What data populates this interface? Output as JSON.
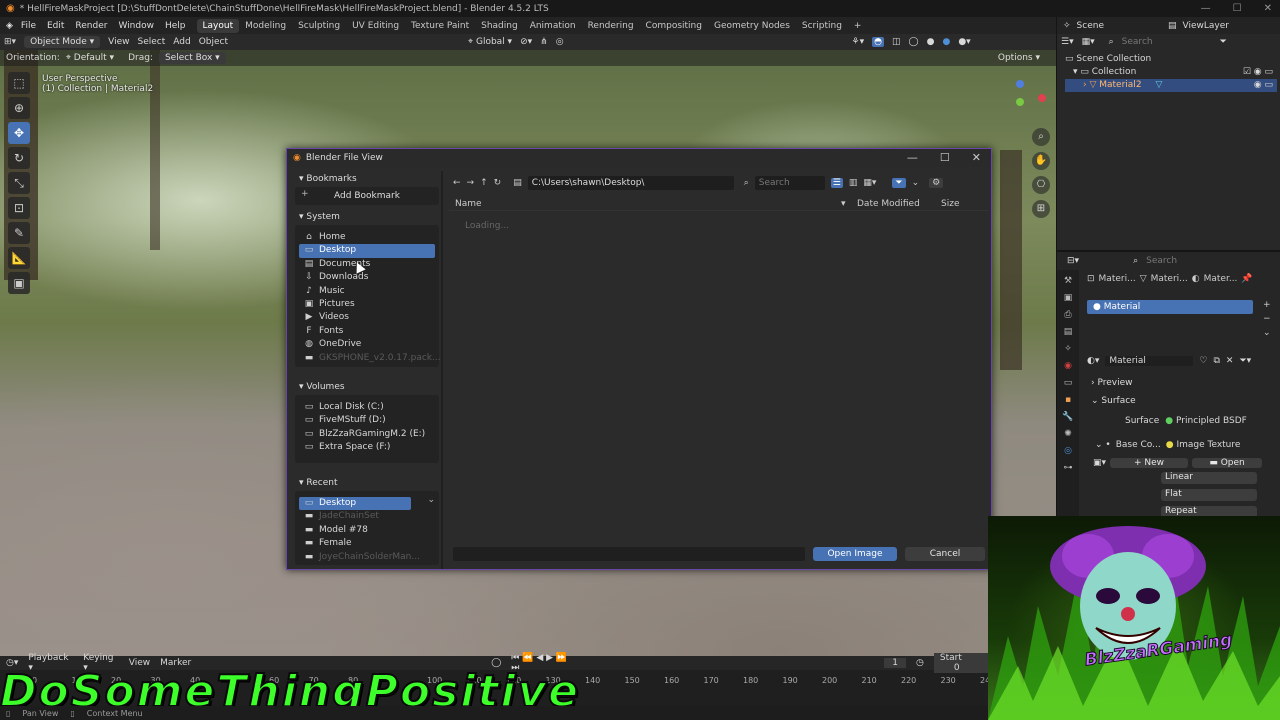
{
  "window": {
    "title": "* HellFireMaskProject [D:\\StuffDontDelete\\ChainStuffDone\\HellFireMask\\HellFireMaskProject.blend] - Blender 4.5.2 LTS"
  },
  "menubar": {
    "menus": [
      "File",
      "Edit",
      "Render",
      "Window",
      "Help"
    ],
    "workspaces": [
      "Layout",
      "Modeling",
      "Sculpting",
      "UV Editing",
      "Texture Paint",
      "Shading",
      "Animation",
      "Rendering",
      "Compositing",
      "Geometry Nodes",
      "Scripting"
    ],
    "active_workspace": "Layout",
    "add_tab": "+",
    "scene": "Scene",
    "view_layer": "ViewLayer"
  },
  "viewport": {
    "mode": "Object Mode",
    "menu": [
      "View",
      "Select",
      "Add",
      "Object"
    ],
    "transform": "Global",
    "orientation_label": "Orientation:",
    "orientation_value": "Default",
    "drag_label": "Drag:",
    "drag_value": "Select Box",
    "options": "Options",
    "overlay_line1": "User Perspective",
    "overlay_line2": "(1) Collection | Material2"
  },
  "outliner": {
    "search_placeholder": "Search",
    "root": "Scene Collection",
    "collection": "Collection",
    "object": "Material2"
  },
  "properties": {
    "search_placeholder": "Search",
    "breadcrumb": [
      "Materi...",
      "Materi...",
      "Mater..."
    ],
    "slot": "Material",
    "material_name": "Material",
    "preview": "Preview",
    "surface": "Surface",
    "surface_label": "Surface",
    "surface_value": "Principled BSDF",
    "base_color_label": "Base Co...",
    "base_color_value": "Image Texture",
    "new": "New",
    "open": "Open",
    "interpolation": "Linear",
    "projection": "Flat",
    "extension": "Repeat"
  },
  "file_dialog": {
    "title": "Blender File View",
    "bookmarks": "Bookmarks",
    "add_bookmark": "Add Bookmark",
    "system": "System",
    "system_items": [
      "Home",
      "Desktop",
      "Documents",
      "Downloads",
      "Music",
      "Pictures",
      "Videos",
      "Fonts",
      "OneDrive",
      "GKSPHONE_v2.0.17.pack..."
    ],
    "system_selected": "Desktop",
    "volumes": "Volumes",
    "volume_items": [
      "Local Disk (C:)",
      "FiveMStuff (D:)",
      "BlzZzaRGamingM.2 (E:)",
      "Extra Space (F:)"
    ],
    "recent": "Recent",
    "recent_items": [
      "Desktop",
      "JadeChainSet",
      "Model #78",
      "Female",
      "JoyeChainSolderMan..."
    ],
    "path": "C:\\Users\\shawn\\Desktop\\",
    "search_placeholder": "Search",
    "col_name": "Name",
    "col_date": "Date Modified",
    "col_size": "Size",
    "loading": "Loading...",
    "filename": "",
    "open_button": "Open Image",
    "cancel_button": "Cancel"
  },
  "timeline": {
    "playback": "Playback",
    "keying": "Keying",
    "view": "View",
    "marker": "Marker",
    "current_frame": "1",
    "start_label": "Start",
    "start_value": "0",
    "ticks": [
      "0",
      "10",
      "20",
      "30",
      "40",
      "50",
      "60",
      "70",
      "80",
      "90",
      "100",
      "110",
      "120",
      "130",
      "140",
      "150",
      "160",
      "170",
      "180",
      "190",
      "200",
      "210",
      "220",
      "230",
      "240"
    ]
  },
  "status": {
    "left1": "Pan View",
    "left2": "Context Menu"
  },
  "overlay": {
    "banner": "DoSomeThingPositive",
    "logo_text": "BlzZzaRGaming"
  },
  "colors": {
    "accent": "#4772b3",
    "dialog_border": "#6a46a8",
    "banner": "#3dff2a"
  }
}
